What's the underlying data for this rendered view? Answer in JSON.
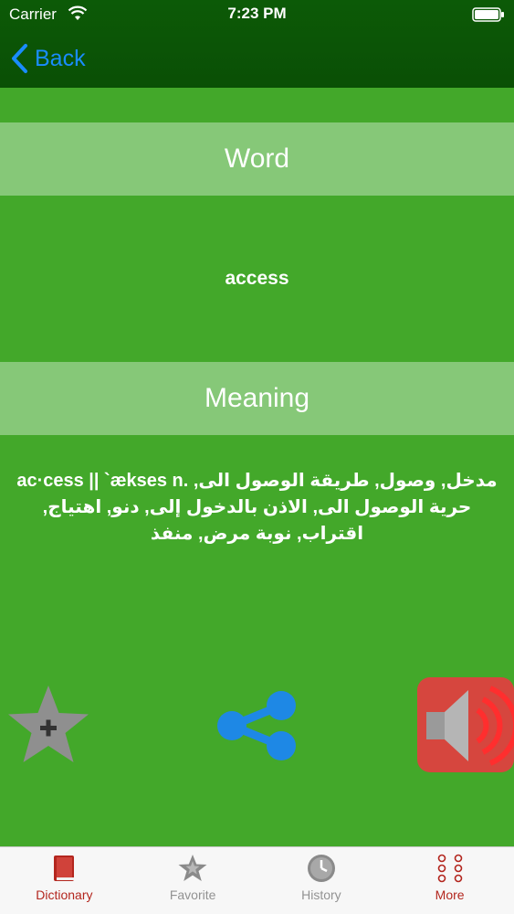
{
  "status_bar": {
    "carrier": "Carrier",
    "time": "7:23 PM"
  },
  "nav": {
    "back_label": "Back"
  },
  "sections": {
    "word_header": "Word",
    "word_value": "access",
    "meaning_header": "Meaning",
    "meaning_text": "ac·cess || `ækses n. مدخل, وصول, طريقة الوصول الى, حرية الوصول الى, الاذن بالدخول إلى, دنو, اهتياج, اقتراب, نوبة مرض, منفذ"
  },
  "tabs": [
    {
      "label": "Dictionary",
      "icon": "book-icon"
    },
    {
      "label": "Favorite",
      "icon": "star-icon"
    },
    {
      "label": "History",
      "icon": "clock-icon"
    },
    {
      "label": "More",
      "icon": "more-dots-icon"
    }
  ],
  "colors": {
    "nav_bg": "#0c5a07",
    "content_bg": "#43a82a",
    "header_bg": "#86c878",
    "back_blue": "#1a8cff",
    "share_blue": "#1e88e5",
    "speaker_red": "#d6463e",
    "tab_active_red": "#b3261e",
    "tab_inactive_gray": "#929292"
  }
}
